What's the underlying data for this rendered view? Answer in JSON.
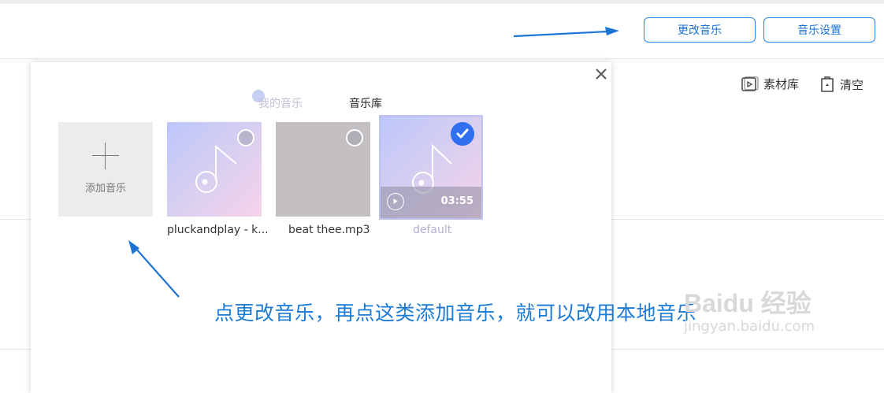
{
  "header": {
    "change_music_label": "更改音乐",
    "music_settings_label": "音乐设置"
  },
  "toolbar": {
    "library_label": "素材库",
    "clear_label": "清空"
  },
  "dialog": {
    "tabs": [
      {
        "label": "我的音乐",
        "active": false
      },
      {
        "label": "音乐库",
        "active": true
      }
    ],
    "add_label": "添加音乐",
    "tracks": [
      {
        "name": "pluckandplay - k...",
        "selected": false
      },
      {
        "name": "beat thee.mp3",
        "selected": false
      },
      {
        "name": "default",
        "selected": true,
        "duration": "03:55"
      }
    ]
  },
  "annotation": "点更改音乐，再点这类添加音乐，就可以改用本地音乐",
  "watermark": {
    "logo": "Baidu 经验",
    "url": "jingyan.baidu.com"
  },
  "colors": {
    "accent": "#1e74d4",
    "selected": "#2f6ff0",
    "annotation": "#1a7ad6"
  }
}
